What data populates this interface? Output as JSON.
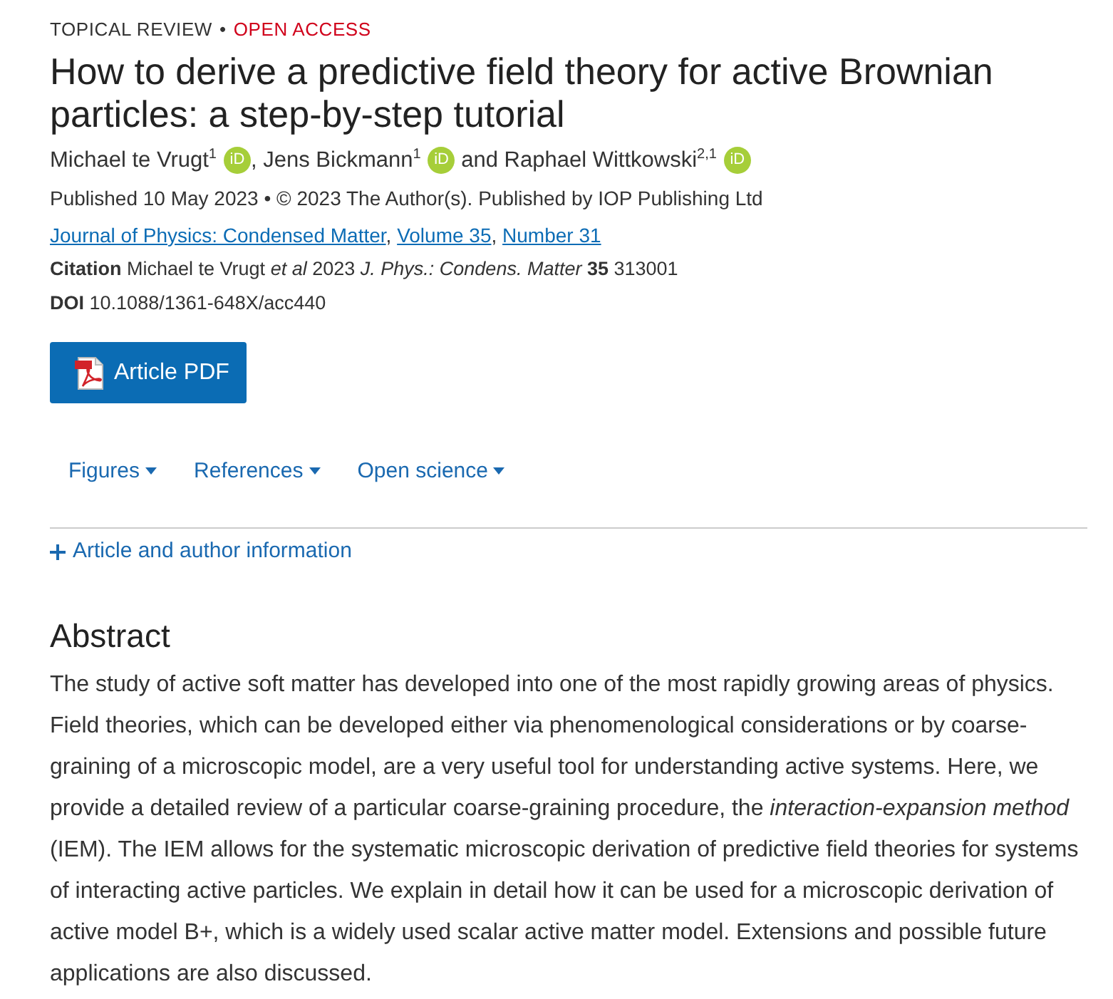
{
  "header": {
    "article_type": "TOPICAL REVIEW",
    "separator": "•",
    "access": "OPEN ACCESS"
  },
  "title": "How to derive a predictive field theory for active Brownian particles: a step-by-step tutorial",
  "authors": [
    {
      "name": "Michael te Vrugt$^{1}$",
      "orcid": "iD",
      "trailing": ","
    },
    {
      "name": "Jens Bickmann$^{1}$",
      "orcid": "iD"
    },
    {
      "connector": "and",
      "name": "Raphael Wittkowski$^{2,1}$",
      "orcid": "iD"
    }
  ],
  "publication_info": "Published 10 May 2023 • © 2023 The Author(s). Published by IOP Publishing Ltd",
  "journal_links": [
    {
      "label": "Journal of Physics: Condensed Matter",
      "trailing": ","
    },
    {
      "label": "Volume 35",
      "trailing": ","
    },
    {
      "label": "Number 31"
    }
  ],
  "citation": {
    "label": "Citation",
    "text": "Michael te Vrugt *et al* 2023 *J. Phys.: Condens. Matter* **35** 313001"
  },
  "doi": {
    "label": "DOI",
    "value": "10.1088/1361-648X/acc440"
  },
  "pdf_button": {
    "label": "Article PDF"
  },
  "tabs": [
    {
      "label": "Figures"
    },
    {
      "label": "References"
    },
    {
      "label": "Open science"
    }
  ],
  "article_info": {
    "label": "Article and author information",
    "expanded": false
  },
  "abstract": {
    "heading": "Abstract",
    "text": "The study of active soft matter has developed into one of the most rapidly growing areas of physics. Field theories, which can be developed either via phenomenological considerations or by coarse-graining of a microscopic model, are a very useful tool for understanding active systems. Here, we provide a detailed review of a particular coarse-graining procedure, the *interaction-expansion method* (IEM). The IEM allows for the systematic microscopic derivation of predictive field theories for systems of interacting active particles. We explain in detail how it can be used for a microscopic derivation of active model B+, which is a widely used scalar active matter model. Extensions and possible future applications are also discussed."
  }
}
